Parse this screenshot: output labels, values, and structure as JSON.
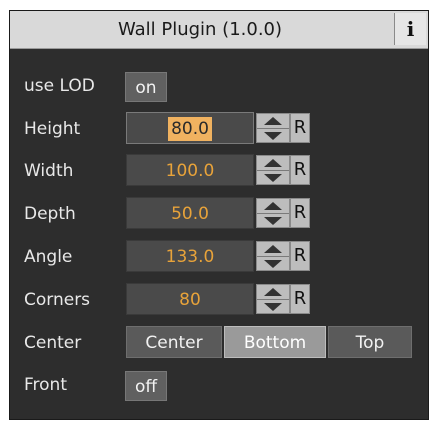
{
  "title": "Wall Plugin (1.0.0)",
  "info_label": "i",
  "use_lod": {
    "label": "use LOD",
    "value": "on"
  },
  "rows": [
    {
      "label": "Height",
      "value": "80.0",
      "reset": "R"
    },
    {
      "label": "Width",
      "value": "100.0",
      "reset": "R"
    },
    {
      "label": "Depth",
      "value": "50.0",
      "reset": "R"
    },
    {
      "label": "Angle",
      "value": "133.0",
      "reset": "R"
    },
    {
      "label": "Corners",
      "value": "80",
      "reset": "R"
    }
  ],
  "center": {
    "label": "Center",
    "options": [
      "Center",
      "Bottom",
      "Top"
    ],
    "selected": "Bottom"
  },
  "front": {
    "label": "Front",
    "value": "off"
  },
  "colors": {
    "panel": "#2d2d2d",
    "value_text": "#e8a33a",
    "selection": "#f0b260",
    "titlebar": "#d9d9d9"
  }
}
